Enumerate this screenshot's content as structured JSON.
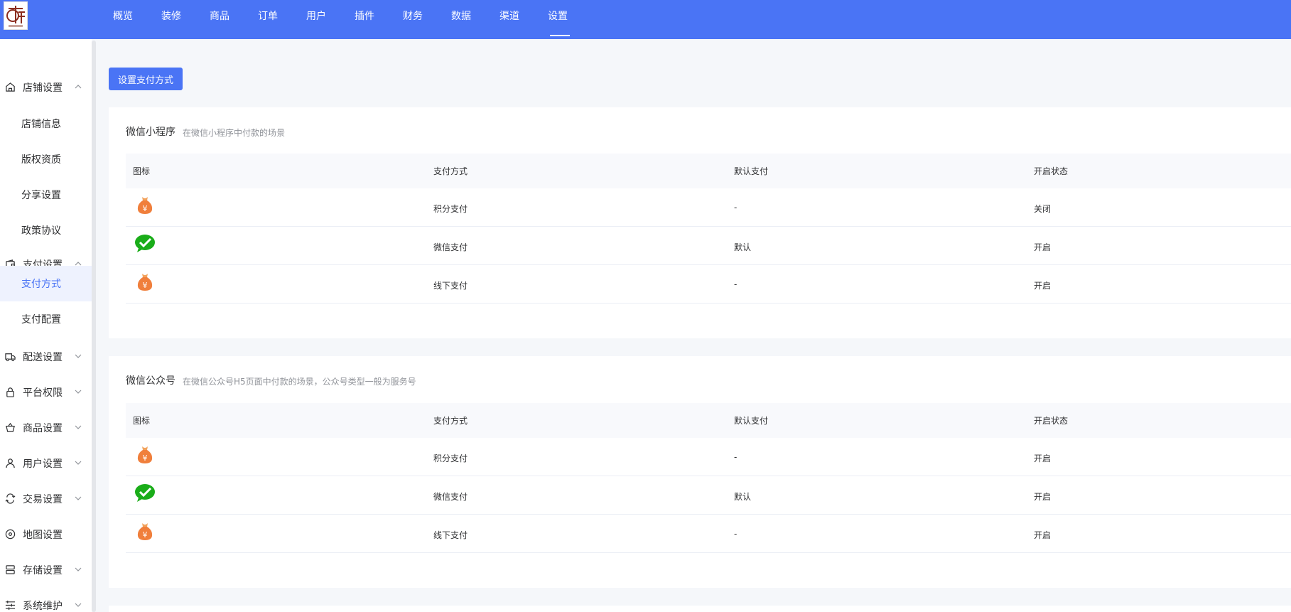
{
  "header": {
    "nav": [
      {
        "label": "概览"
      },
      {
        "label": "装修"
      },
      {
        "label": "商品"
      },
      {
        "label": "订单"
      },
      {
        "label": "用户"
      },
      {
        "label": "插件"
      },
      {
        "label": "财务"
      },
      {
        "label": "数据"
      },
      {
        "label": "渠道"
      },
      {
        "label": "设置",
        "active": true
      }
    ],
    "accent_color": "#4a74f5"
  },
  "sidebar": {
    "groups": [
      {
        "label": "店铺设置",
        "icon": "home-icon",
        "expanded": true
      },
      {
        "label": "支付设置",
        "icon": "wallet-icon",
        "expanded": true
      },
      {
        "label": "配送设置",
        "icon": "truck-icon",
        "expanded": false
      },
      {
        "label": "平台权限",
        "icon": "lock-icon",
        "expanded": false
      },
      {
        "label": "商品设置",
        "icon": "basket-icon",
        "expanded": false
      },
      {
        "label": "用户设置",
        "icon": "user-icon",
        "expanded": false
      },
      {
        "label": "交易设置",
        "icon": "exchange-icon",
        "expanded": false
      },
      {
        "label": "地图设置",
        "icon": "map-pin-icon",
        "expanded": false
      },
      {
        "label": "存储设置",
        "icon": "storage-icon",
        "expanded": false
      },
      {
        "label": "系统维护",
        "icon": "list-icon",
        "expanded": false
      }
    ],
    "shop_items": [
      "店铺信息",
      "版权资质",
      "分享设置",
      "政策协议"
    ],
    "pay_items": [
      "支付方式",
      "支付配置"
    ],
    "active_item": "支付方式"
  },
  "main": {
    "set_button": "设置支付方式",
    "sections": [
      {
        "title": "微信小程序",
        "desc": "在微信小程序中付款的场景",
        "headers": [
          "图标",
          "支付方式",
          "默认支付",
          "开启状态"
        ],
        "rows": [
          {
            "icon": "money-bag-icon",
            "method": "积分支付",
            "default": "-",
            "status": "关闭"
          },
          {
            "icon": "wechat-pay-icon",
            "method": "微信支付",
            "default": "默认",
            "status": "开启"
          },
          {
            "icon": "money-bag-icon",
            "method": "线下支付",
            "default": "-",
            "status": "开启"
          }
        ]
      },
      {
        "title": "微信公众号",
        "desc": "在微信公众号H5页面中付款的场景，公众号类型一般为服务号",
        "headers": [
          "图标",
          "支付方式",
          "默认支付",
          "开启状态"
        ],
        "rows": [
          {
            "icon": "money-bag-icon",
            "method": "积分支付",
            "default": "-",
            "status": "开启"
          },
          {
            "icon": "wechat-pay-icon",
            "method": "微信支付",
            "default": "默认",
            "status": "开启"
          },
          {
            "icon": "money-bag-icon",
            "method": "线下支付",
            "default": "-",
            "status": "开启"
          }
        ]
      }
    ]
  }
}
